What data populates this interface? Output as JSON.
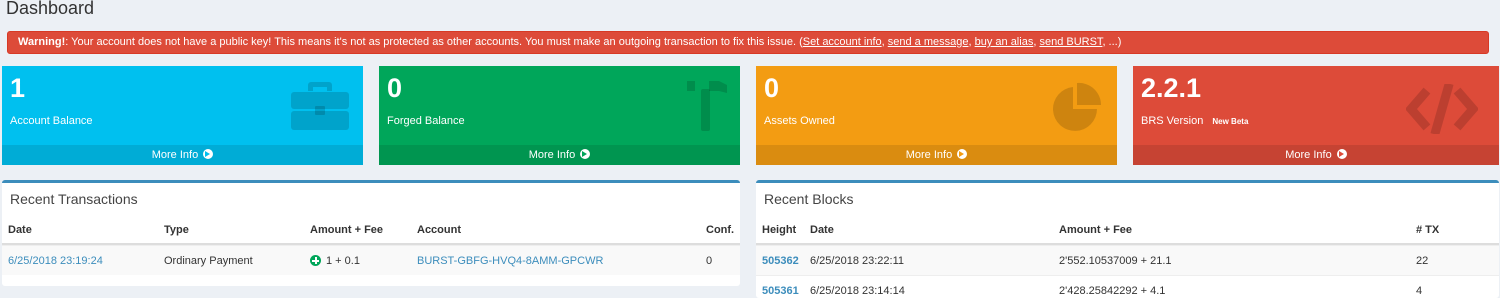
{
  "page": {
    "title": "Dashboard"
  },
  "alert": {
    "strong": "Warning!",
    "message": ": Your account does not have a public key! This means it's not as protected as other accounts. You must make an outgoing transaction to fix this issue. (",
    "links": [
      "Set account info",
      "send a message",
      "buy an alias",
      "send BURST"
    ],
    "sep": ", ",
    "tail": ", ...)"
  },
  "boxes": [
    {
      "value": "1",
      "label": "Account Balance",
      "footer": "More Info",
      "icon": "briefcase-icon",
      "color": "#00c0ef"
    },
    {
      "value": "0",
      "label": "Forged Balance",
      "footer": "More Info",
      "icon": "hammer-icon",
      "color": "#00a65a"
    },
    {
      "value": "0",
      "label": "Assets Owned",
      "footer": "More Info",
      "icon": "pie-chart-icon",
      "color": "#f39c12"
    },
    {
      "value": "2.2.1",
      "label": "BRS Version",
      "badge": "New Beta",
      "footer": "More Info",
      "icon": "code-icon",
      "color": "#dd4b39"
    }
  ],
  "transactions": {
    "title": "Recent Transactions",
    "columns": [
      "Date",
      "Type",
      "Amount + Fee",
      "Account",
      "Conf."
    ],
    "rows": [
      {
        "date": "6/25/2018 23:19:24",
        "type": "Ordinary Payment",
        "amount": "1 + 0.1",
        "account": "BURST-GBFG-HVQ4-8AMM-GPCWR",
        "conf": "0"
      }
    ]
  },
  "blocks": {
    "title": "Recent Blocks",
    "columns": [
      "Height",
      "Date",
      "Amount + Fee",
      "# TX"
    ],
    "rows": [
      {
        "height": "505362",
        "date": "6/25/2018 23:22:11",
        "amount": "2'552.10537009 + 21.1",
        "tx": "22"
      },
      {
        "height": "505361",
        "date": "6/25/2018 23:14:14",
        "amount": "2'428.25842292 + 4.1",
        "tx": "4"
      }
    ]
  }
}
